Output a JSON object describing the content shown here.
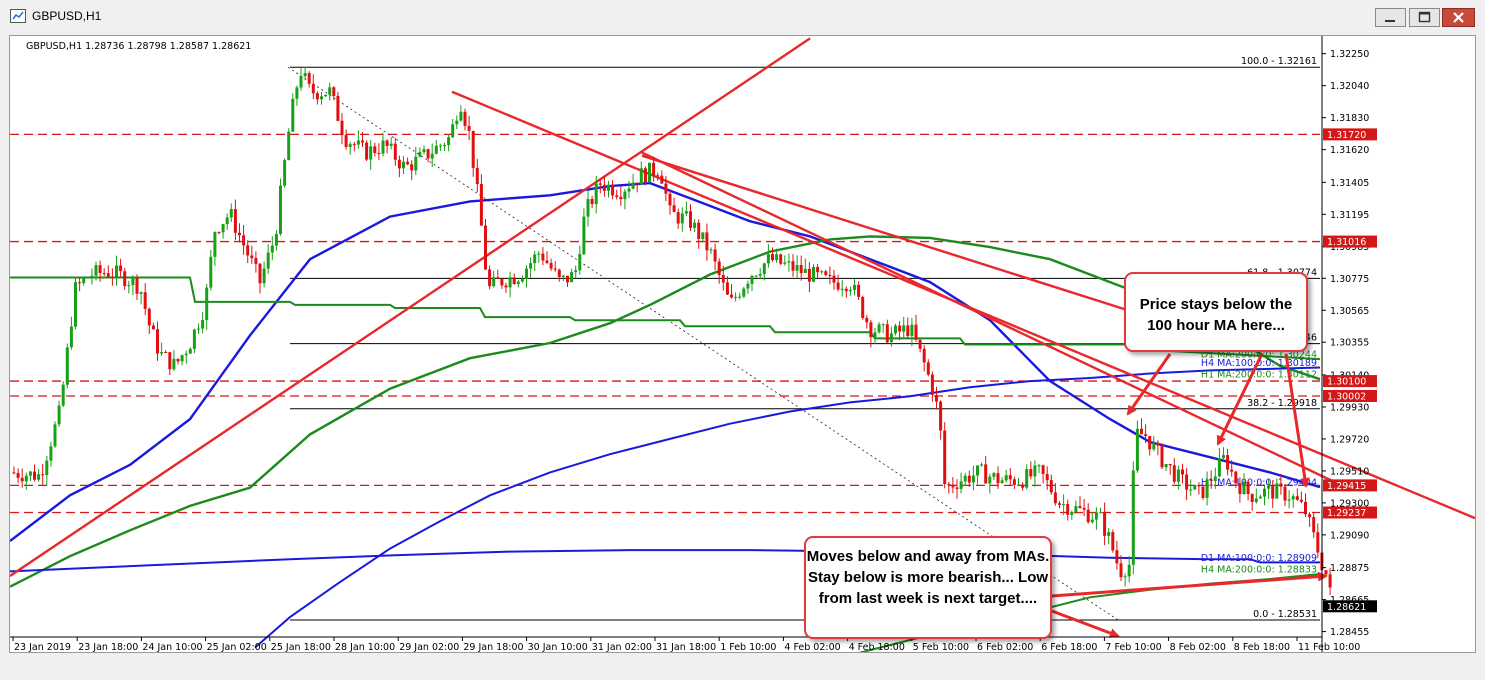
{
  "window": {
    "title": "GBPUSD,H1"
  },
  "chart_info": {
    "symbol_line": "GBPUSD,H1  1.28736 1.28798 1.28587 1.28621"
  },
  "callouts": [
    {
      "text": "Price stays below the 100 hour MA here..."
    },
    {
      "text": "Moves below and away from MAs.  Stay below is more bearish... Low from last week is next target...."
    }
  ],
  "colors": {
    "bull_candle": "#18a018",
    "bear_candle": "#e01010",
    "trendline": "#e8282a",
    "ma_blue": "#1a1adc",
    "ma_green": "#1c8a1c",
    "price_tag": "#d41818",
    "background": "#ffffff"
  },
  "chart_data": {
    "type": "candlestick",
    "symbol": "GBPUSD",
    "timeframe": "H1",
    "ylim": [
      1.2838,
      1.3232
    ],
    "last_price": 1.28621,
    "y_ticks": [
      "1.32250",
      "1.32040",
      "1.31830",
      "1.31620",
      "1.31405",
      "1.31195",
      "1.30985",
      "1.30775",
      "1.30565",
      "1.30355",
      "1.30140",
      "1.29930",
      "1.29720",
      "1.29510",
      "1.29300",
      "1.29090",
      "1.28875",
      "1.28665",
      "1.28455"
    ],
    "x_ticks": [
      "23 Jan 2019",
      "23 Jan 18:00",
      "24 Jan 10:00",
      "25 Jan 02:00",
      "25 Jan 18:00",
      "28 Jan 10:00",
      "29 Jan 02:00",
      "29 Jan 18:00",
      "30 Jan 10:00",
      "31 Jan 02:00",
      "31 Jan 18:00",
      "1 Feb 10:00",
      "4 Feb 02:00",
      "4 Feb 18:00",
      "5 Feb 10:00",
      "6 Feb 02:00",
      "6 Feb 18:00",
      "7 Feb 10:00",
      "8 Feb 02:00",
      "8 Feb 18:00",
      "11 Feb 10:00"
    ],
    "price_tags": [
      "1.31720",
      "1.31016",
      "1.30100",
      "1.30002",
      "1.29415",
      "1.29237",
      "1.28621"
    ],
    "horizontal_levels": [
      {
        "label": "1.31720",
        "value": 1.3172
      },
      {
        "label": "1.31016",
        "value": 1.31016
      },
      {
        "label": "1.30100",
        "value": 1.301
      },
      {
        "label": "1.30002",
        "value": 1.30002
      },
      {
        "label": "1.29415",
        "value": 1.29415
      },
      {
        "label": "1.29237",
        "value": 1.29237
      }
    ],
    "fibonacci": [
      {
        "label": "100.0 - 1.32161",
        "value": 1.32161
      },
      {
        "label": "61.8 - 1.30774",
        "value": 1.30774
      },
      {
        "label": "50.0 - 1.30346",
        "value": 1.30346
      },
      {
        "label": "38.2 - 1.29918",
        "value": 1.29918
      },
      {
        "label": "0.0 - 1.28531",
        "value": 1.28531
      }
    ],
    "ma_labels": [
      {
        "label": "D1 MA:200:0:0: 1.30244",
        "value": 1.30244,
        "color": "green"
      },
      {
        "label": "H4 MA:100:0:0: 1.30189",
        "value": 1.30189,
        "color": "blue"
      },
      {
        "label": "H1 MA:200:0:0: 1.30112",
        "value": 1.30112,
        "color": "green"
      },
      {
        "label": "H1 MA:100:0:0: 1.29404",
        "value": 1.29404,
        "color": "blue"
      },
      {
        "label": "D1 MA:100:0:0: 1.28909",
        "value": 1.28909,
        "color": "blue"
      },
      {
        "label": "H4 MA:200:0:0: 1.28833",
        "value": 1.28833,
        "color": "green"
      }
    ],
    "price_path": [
      [
        0,
        1.295
      ],
      [
        30,
        1.2948
      ],
      [
        50,
        1.299
      ],
      [
        65,
        1.307
      ],
      [
        80,
        1.308
      ],
      [
        100,
        1.3082
      ],
      [
        115,
        1.3078
      ],
      [
        130,
        1.3072
      ],
      [
        140,
        1.3045
      ],
      [
        150,
        1.3028
      ],
      [
        165,
        1.302
      ],
      [
        180,
        1.3035
      ],
      [
        195,
        1.306
      ],
      [
        205,
        1.311
      ],
      [
        220,
        1.312
      ],
      [
        240,
        1.309
      ],
      [
        250,
        1.3075
      ],
      [
        265,
        1.3105
      ],
      [
        280,
        1.318
      ],
      [
        290,
        1.3215
      ],
      [
        300,
        1.32
      ],
      [
        320,
        1.32
      ],
      [
        335,
        1.317
      ],
      [
        355,
        1.316
      ],
      [
        375,
        1.3165
      ],
      [
        395,
        1.315
      ],
      [
        420,
        1.316
      ],
      [
        440,
        1.317
      ],
      [
        450,
        1.3195
      ],
      [
        460,
        1.317
      ],
      [
        470,
        1.312
      ],
      [
        478,
        1.307
      ],
      [
        488,
        1.3075
      ],
      [
        510,
        1.308
      ],
      [
        530,
        1.3095
      ],
      [
        550,
        1.3075
      ],
      [
        565,
        1.308
      ],
      [
        575,
        1.312
      ],
      [
        590,
        1.314
      ],
      [
        610,
        1.3135
      ],
      [
        630,
        1.3145
      ],
      [
        650,
        1.315
      ],
      [
        660,
        1.312
      ],
      [
        680,
        1.3115
      ],
      [
        700,
        1.3095
      ],
      [
        720,
        1.306
      ],
      [
        740,
        1.308
      ],
      [
        760,
        1.309
      ],
      [
        780,
        1.3085
      ],
      [
        800,
        1.308
      ],
      [
        820,
        1.3075
      ],
      [
        840,
        1.3075
      ],
      [
        850,
        1.306
      ],
      [
        860,
        1.3045
      ],
      [
        880,
        1.304
      ],
      [
        900,
        1.3045
      ],
      [
        915,
        1.302
      ],
      [
        925,
        1.3
      ],
      [
        930,
        1.298
      ],
      [
        935,
        1.294
      ],
      [
        950,
        1.2945
      ],
      [
        970,
        1.295
      ],
      [
        990,
        1.2945
      ],
      [
        1010,
        1.2945
      ],
      [
        1030,
        1.295
      ],
      [
        1050,
        1.293
      ],
      [
        1070,
        1.2925
      ],
      [
        1090,
        1.292
      ],
      [
        1100,
        1.2905
      ],
      [
        1110,
        1.2885
      ],
      [
        1120,
        1.289
      ],
      [
        1125,
        1.2975
      ],
      [
        1135,
        1.2975
      ],
      [
        1150,
        1.296
      ],
      [
        1170,
        1.2945
      ],
      [
        1190,
        1.2935
      ],
      [
        1205,
        1.295
      ],
      [
        1215,
        1.296
      ],
      [
        1225,
        1.2945
      ],
      [
        1240,
        1.2935
      ],
      [
        1260,
        1.2938
      ],
      [
        1280,
        1.2935
      ],
      [
        1295,
        1.2925
      ],
      [
        1305,
        1.2905
      ],
      [
        1312,
        1.289
      ],
      [
        1318,
        1.288
      ],
      [
        1322,
        1.2862
      ]
    ]
  }
}
